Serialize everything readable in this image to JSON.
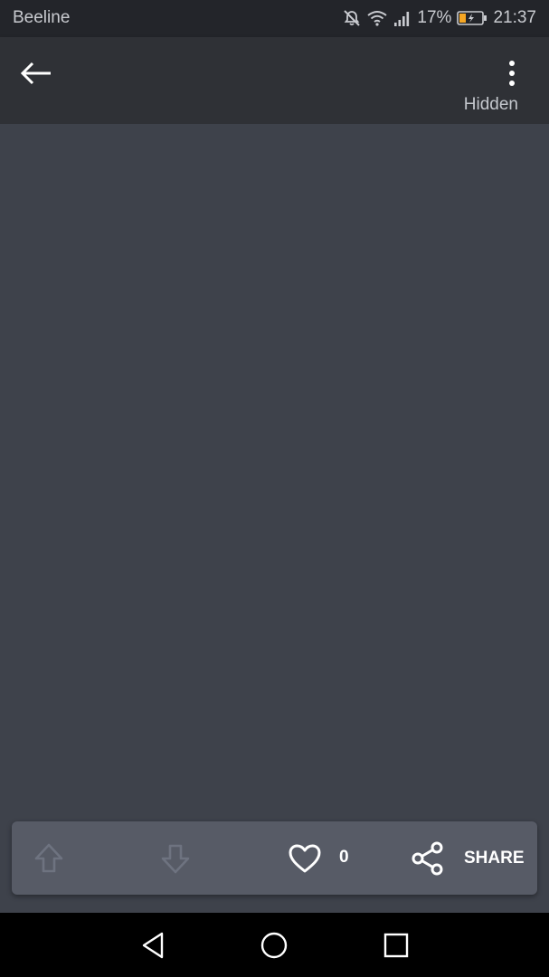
{
  "status_bar": {
    "carrier": "Beeline",
    "battery_percent": "17%",
    "time": "21:37",
    "icons": [
      "mute-icon",
      "wifi-icon",
      "signal-icon",
      "battery-icon"
    ],
    "battery_color": "#f5a623"
  },
  "app_bar": {
    "back_icon": "arrow-back-icon",
    "menu_icon": "more-vertical-icon",
    "status_label": "Hidden"
  },
  "action_bar": {
    "upvote_icon": "arrow-up-outline-icon",
    "downvote_icon": "arrow-down-outline-icon",
    "like_icon": "heart-outline-icon",
    "like_count": "0",
    "share_icon": "share-icon",
    "share_label": "SHARE"
  },
  "nav_bar": {
    "items": [
      "nav-back-icon",
      "nav-home-icon",
      "nav-recents-icon"
    ]
  },
  "colors": {
    "status_bar_bg": "#23252a",
    "app_bar_bg": "#2f3136",
    "content_bg": "#3e424b",
    "action_bar_bg": "#575b66",
    "nav_bar_bg": "#000000",
    "icon_disabled": "#6e7380"
  }
}
